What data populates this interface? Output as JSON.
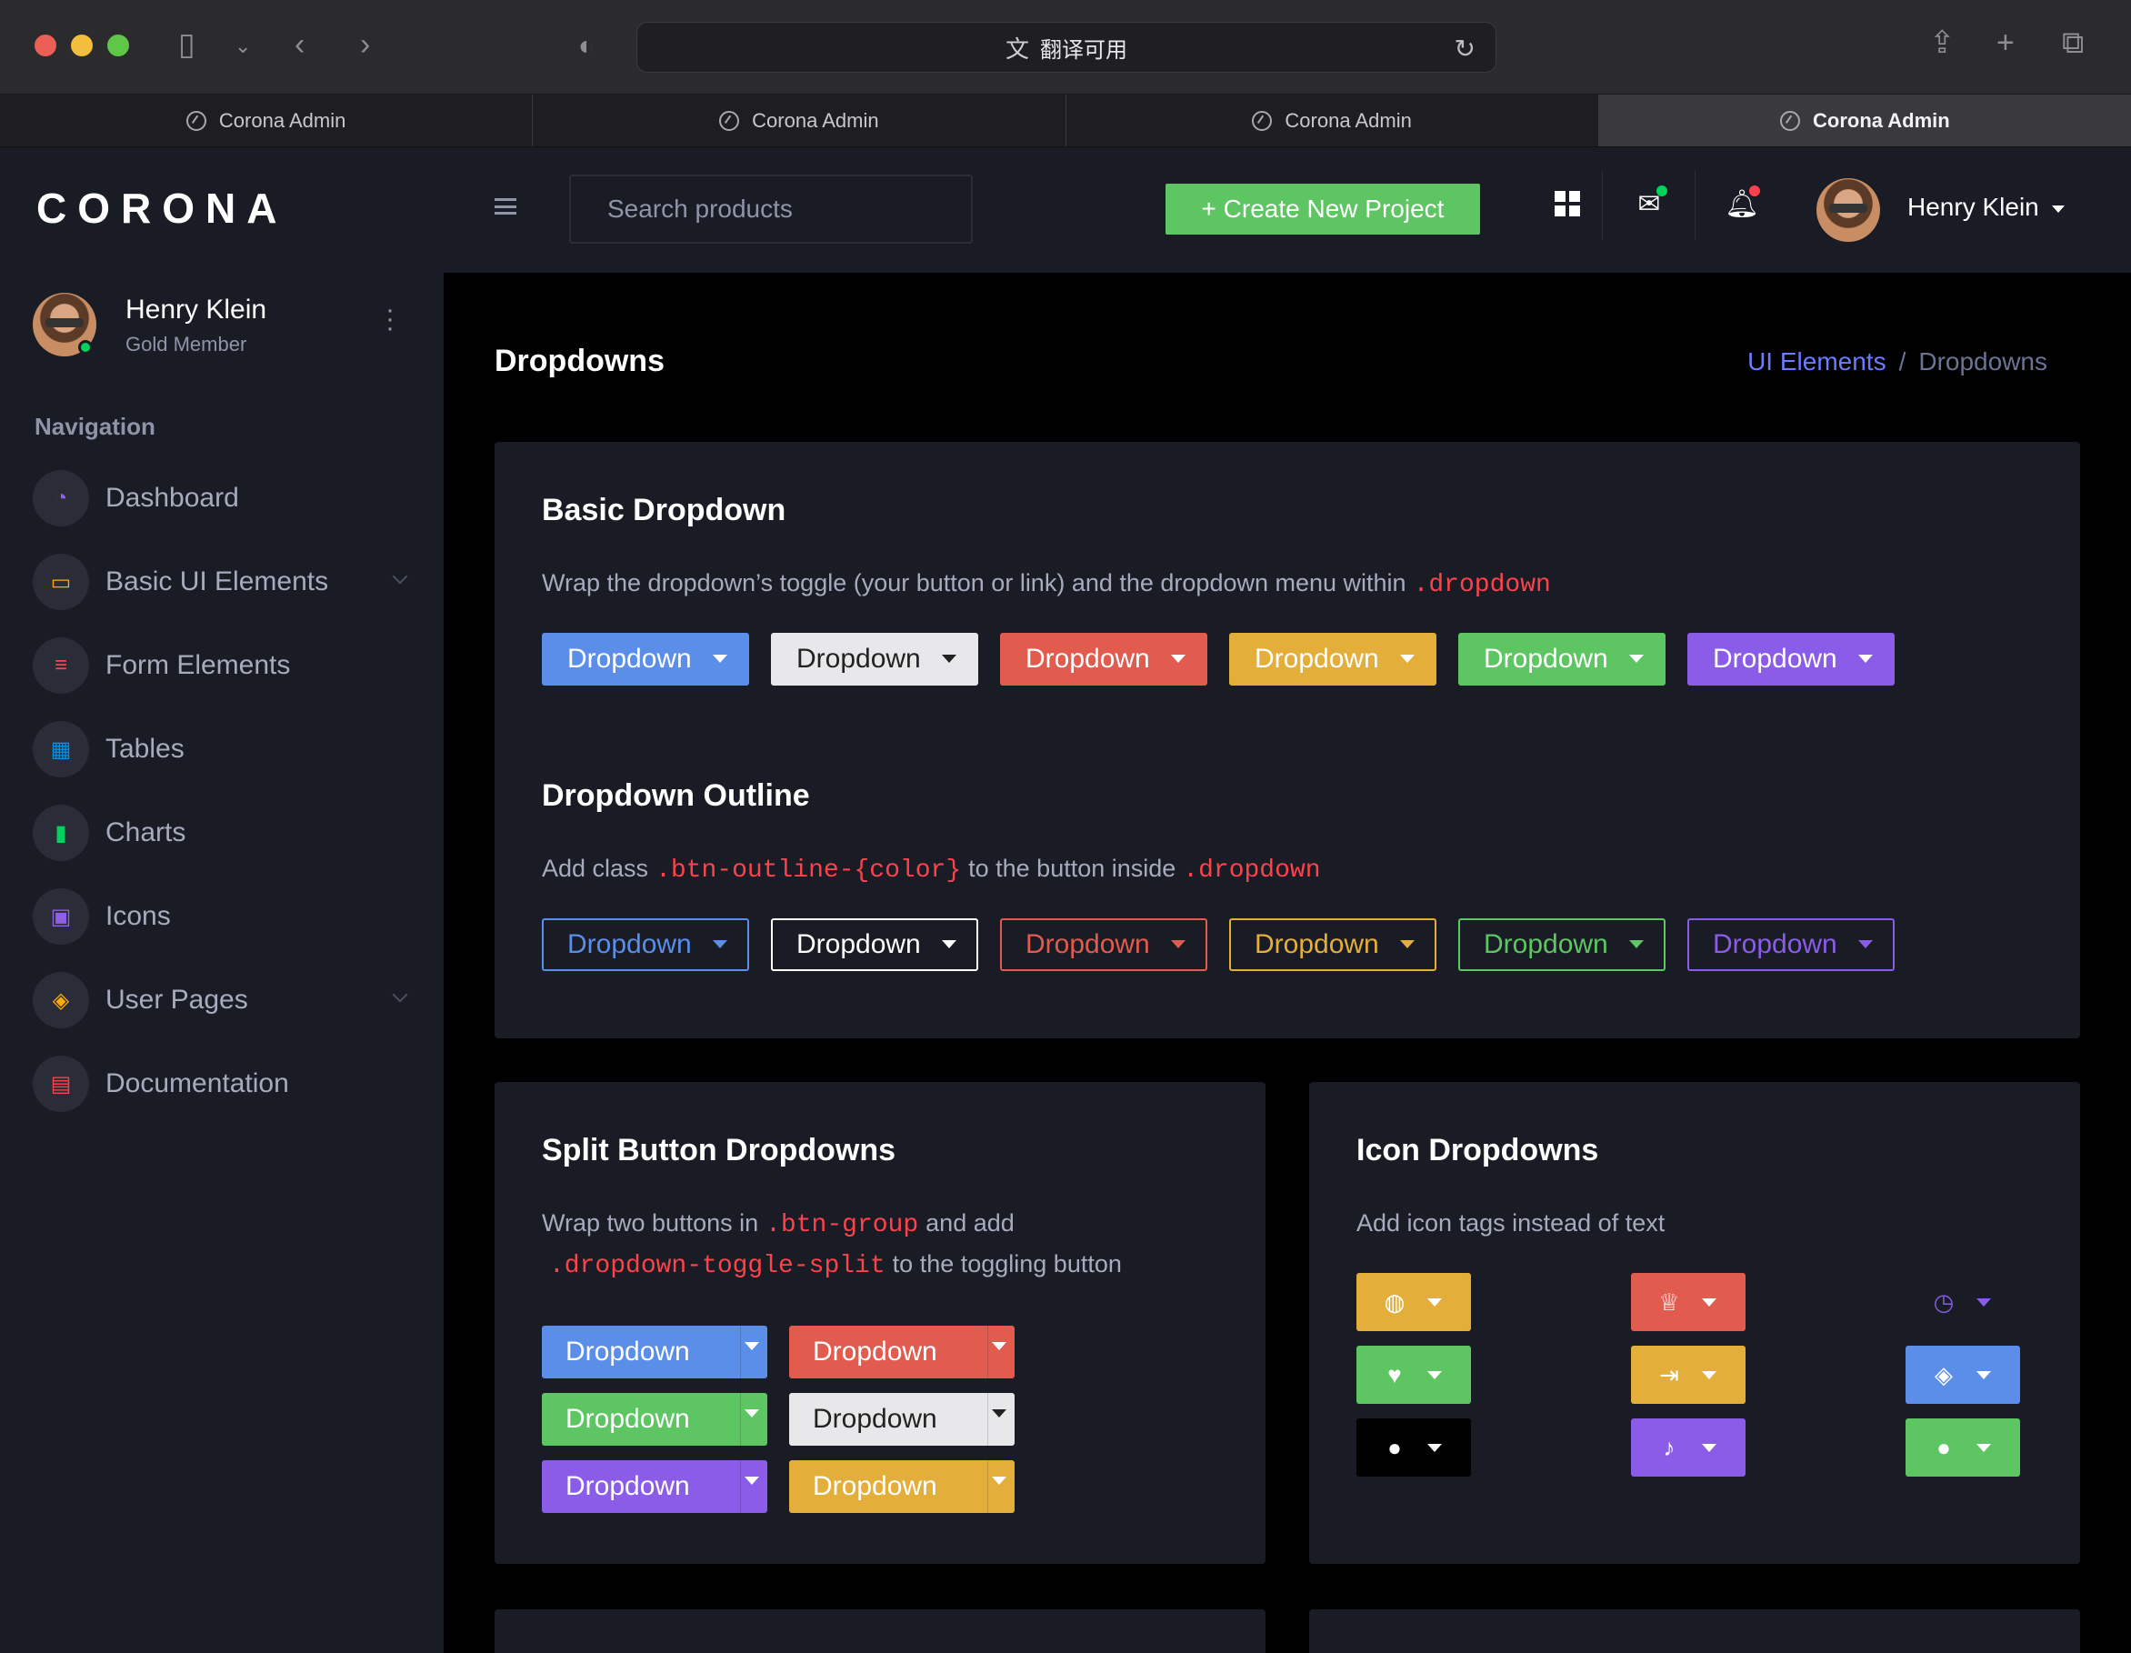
{
  "browser": {
    "url_text": "翻译可用",
    "translate_icon": "translate-icon",
    "tabs": [
      "Corona Admin",
      "Corona Admin",
      "Corona Admin",
      "Corona Admin"
    ]
  },
  "sidebar": {
    "brand": "CORONA",
    "profile": {
      "name": "Henry Klein",
      "role": "Gold Member"
    },
    "nav_heading": "Navigation",
    "items": [
      {
        "label": "Dashboard",
        "icon": "speedometer-icon",
        "color": "#8f5fe8",
        "glyph": "◔"
      },
      {
        "label": "Basic UI Elements",
        "icon": "laptop-icon",
        "color": "#ffab00",
        "glyph": "▭"
      },
      {
        "label": "Form Elements",
        "icon": "list-icon",
        "color": "#fc424a",
        "glyph": "≡"
      },
      {
        "label": "Tables",
        "icon": "table-icon",
        "color": "#0090e7",
        "glyph": "▦"
      },
      {
        "label": "Charts",
        "icon": "chart-icon",
        "color": "#00d25b",
        "glyph": "▮"
      },
      {
        "label": "Icons",
        "icon": "contacts-icon",
        "color": "#8f5fe8",
        "glyph": "▣"
      },
      {
        "label": "User Pages",
        "icon": "security-icon",
        "color": "#ffab00",
        "glyph": "◈"
      },
      {
        "label": "Documentation",
        "icon": "file-document-icon",
        "color": "#fc424a",
        "glyph": "▤"
      }
    ]
  },
  "topbar": {
    "search_placeholder": "Search products",
    "create_label": "+ Create New Project",
    "username": "Henry Klein"
  },
  "page": {
    "title": "Dropdowns",
    "breadcrumb": {
      "parent": "UI Elements",
      "current": "Dropdowns"
    }
  },
  "basic": {
    "title": "Basic Dropdown",
    "desc_prefix": "Wrap the dropdown’s toggle (your button or link) and the dropdown menu within",
    "desc_code": ".dropdown",
    "button_label": "Dropdown"
  },
  "outline": {
    "title": "Dropdown Outline",
    "desc_a": "Add class",
    "desc_code1": ".btn-outline-{color}",
    "desc_b": "to the button inside",
    "desc_code2": ".dropdown",
    "button_label": "Dropdown"
  },
  "split": {
    "title": "Split Button Dropdowns",
    "desc_a": "Wrap two buttons in",
    "desc_code1": ".btn-group",
    "desc_b": "and add",
    "desc_code2": ".dropdown-toggle-split",
    "desc_c": "to the toggling button",
    "button_label": "Dropdown"
  },
  "icons": {
    "title": "Icon Dropdowns",
    "desc": "Add icon tags instead of text",
    "buttons": [
      {
        "icon": "earth-icon",
        "glyph": "◍"
      },
      {
        "icon": "trophy-icon",
        "glyph": "♕"
      },
      {
        "icon": "clock-icon",
        "glyph": "◷"
      },
      {
        "icon": "heart-icon",
        "glyph": "♥"
      },
      {
        "icon": "logout-icon",
        "glyph": "⇥"
      },
      {
        "icon": "shield-icon",
        "glyph": "◈"
      },
      {
        "icon": "account-icon",
        "glyph": "●"
      },
      {
        "icon": "bell-icon",
        "glyph": "♪"
      },
      {
        "icon": "account-icon",
        "glyph": "●"
      }
    ]
  }
}
